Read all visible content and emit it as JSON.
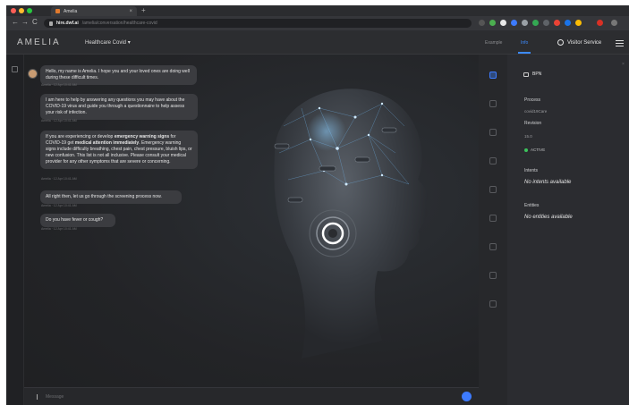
{
  "browser": {
    "tab_title": "Amelia",
    "tab_close": "×",
    "new_tab": "+",
    "url_domain": "hire.dwf.ai",
    "url_path": "/amelia/conversation/healthcare-covid",
    "nav": {
      "back": "←",
      "forward": "→",
      "reload": "C"
    }
  },
  "app": {
    "logo": "AMELIA",
    "domain_select": "Healthcare Covid ▾",
    "tabs": {
      "example": "Example",
      "info": "Info"
    },
    "user_name": "Visitor Service"
  },
  "chat": {
    "messages": [
      {
        "text": "Hello, my name is Amelia. I hope you and your loved ones are doing well during these difficult times.",
        "time": "Amelia · 12 Apr 10:41 AM"
      },
      {
        "text": "I am here to help by answering any questions you may have about the COVID-19 virus and guide you through a questionnaire to help assess your risk of infection.",
        "time": "Amelia · 12 Apr 10:41 AM"
      },
      {
        "text_pre": "If you are experiencing or develop ",
        "text_bold1": "emergency warning signs",
        "text_mid": " for COVID-19 get ",
        "text_bold2": "medical attention immediately",
        "text_post": ". Emergency warning signs include difficulty breathing, chest pain, chest pressure, bluish lips, or new confusion. This list is not all inclusive. Please consult your medical provider for any other symptoms that are severe or concerning.",
        "time": "Amelia · 12 Apr 10:41 AM"
      },
      {
        "text": "All right then, let us go through the screening process now.",
        "time": "Amelia · 12 Apr 10:41 AM"
      },
      {
        "text": "Do you have fever or cough?",
        "time": "Amelia · 12 Apr 10:41 AM"
      }
    ],
    "composer_placeholder": "Message"
  },
  "panel": {
    "close": "×",
    "bpn": "BPN",
    "process_label": "Process",
    "process_value": "covid19Care",
    "revision_label": "Revision",
    "revision_value": "15.0",
    "status": "ACTIVE",
    "status_color": "#3cc35c",
    "intents_label": "Intents",
    "intents_empty": "No intents available",
    "entities_label": "Entities",
    "entities_empty": "No entities available"
  },
  "colors": {
    "accent": "#3d7bff",
    "background": "#1e1f22"
  }
}
